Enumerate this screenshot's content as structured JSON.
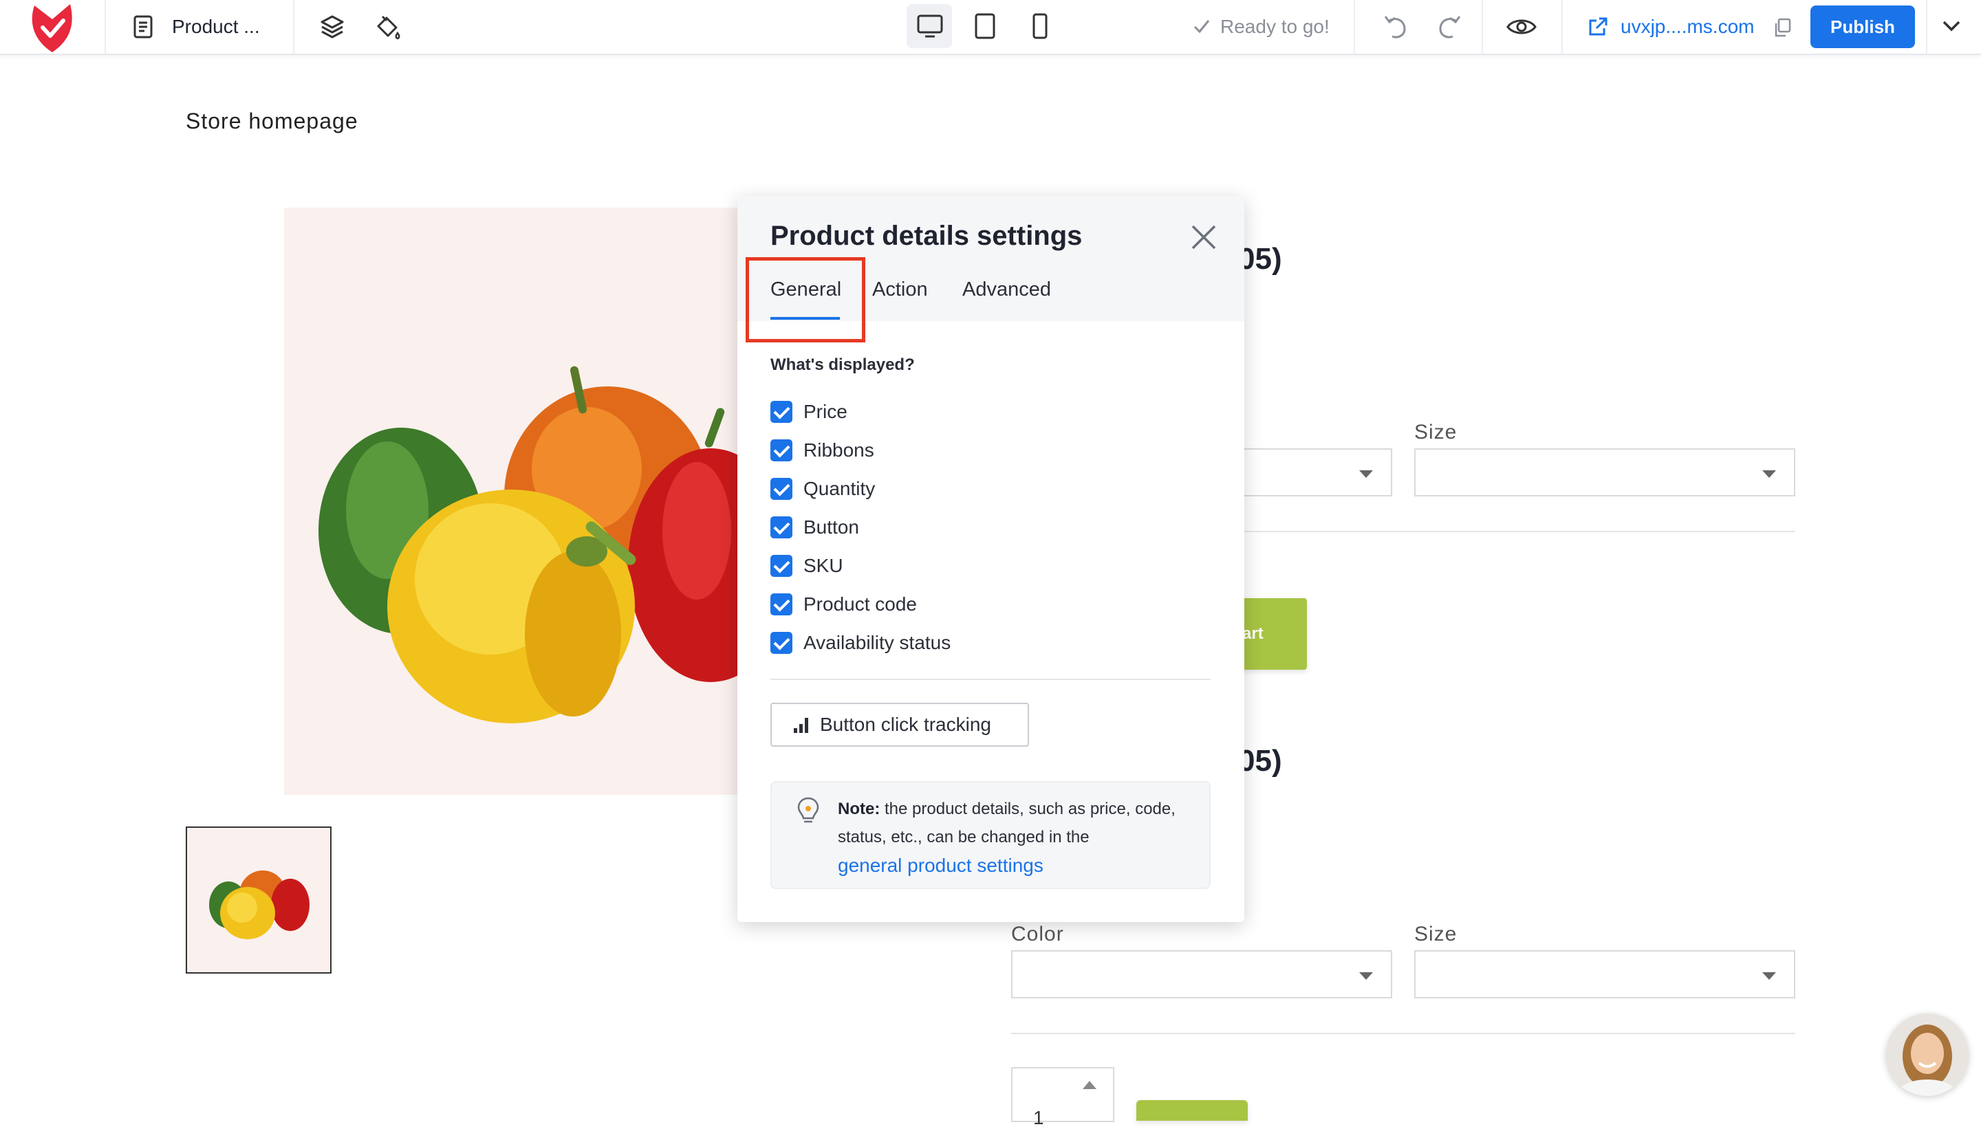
{
  "toolbar": {
    "page_name": "Product ...",
    "status": "Ready to go!",
    "site_url": "uvxjp....ms.com",
    "publish_label": "Publish"
  },
  "page": {
    "store_title": "Store homepage",
    "heading_fragment_1": "05)",
    "heading_fragment_2": "05)",
    "size_label_1": "Size",
    "color_label_2": "Color",
    "size_label_2": "Size",
    "add_to_cart_fragment": "art",
    "quantity_value": "1"
  },
  "panel": {
    "title": "Product details settings",
    "tabs": [
      {
        "label": "General"
      },
      {
        "label": "Action"
      },
      {
        "label": "Advanced"
      }
    ],
    "section_question": "What's displayed?",
    "options": [
      {
        "label": "Price",
        "checked": true
      },
      {
        "label": "Ribbons",
        "checked": true
      },
      {
        "label": "Quantity",
        "checked": true
      },
      {
        "label": "Button",
        "checked": true
      },
      {
        "label": "SKU",
        "checked": true
      },
      {
        "label": "Product code",
        "checked": true
      },
      {
        "label": "Availability status",
        "checked": true
      }
    ],
    "tracking_button": "Button click tracking",
    "note_bold": "Note:",
    "note_text": " the product details, such as price, code, status, etc., can be changed in the",
    "note_link": "general product settings"
  },
  "colors": {
    "accent": "#1a73e8",
    "highlight": "#e53a24",
    "cart_green": "#a8c443",
    "brand_red": "#e8283c"
  }
}
